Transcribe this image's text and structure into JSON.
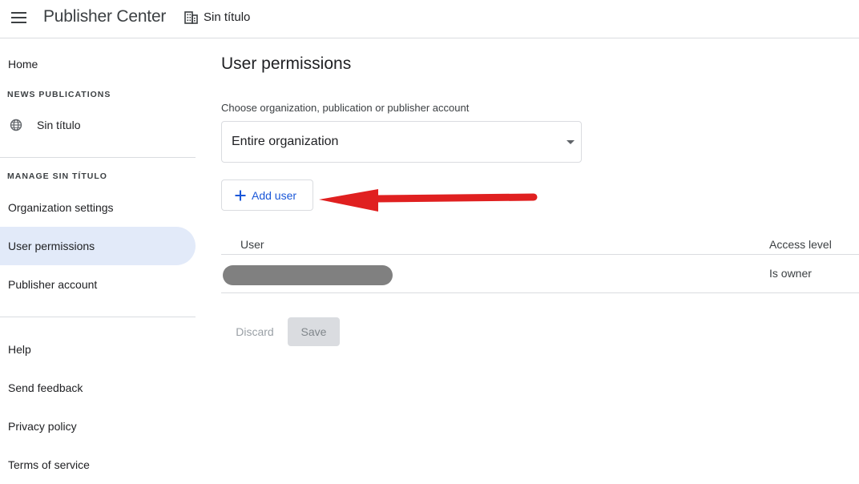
{
  "header": {
    "app_title": "Publisher Center",
    "org_name": "Sin título",
    "icons": {
      "menu": "menu-icon",
      "org": "building-icon"
    }
  },
  "sidebar": {
    "home": "Home",
    "news_publications_label": "NEWS PUBLICATIONS",
    "publication": {
      "label": "Sin título",
      "icon": "globe-icon"
    },
    "manage_label": "MANAGE SIN TÍTULO",
    "manage_items": [
      {
        "label": "Organization settings"
      },
      {
        "label": "User permissions",
        "active": true
      },
      {
        "label": "Publisher account"
      }
    ],
    "footer_items": [
      {
        "label": "Help"
      },
      {
        "label": "Send feedback"
      },
      {
        "label": "Privacy policy"
      },
      {
        "label": "Terms of service"
      }
    ],
    "active_color": "#e2eaf9"
  },
  "main": {
    "title": "User permissions",
    "select_label": "Choose organization, publication or publisher account",
    "select_value": "Entire organization",
    "add_user_label": "Add user",
    "table": {
      "headers": [
        "User",
        "Access level"
      ],
      "rows": [
        {
          "user": "",
          "access_level": "Is owner"
        }
      ]
    },
    "discard_label": "Discard",
    "save_label": "Save",
    "accent_color": "#1a57d8",
    "annotation_color": "#e02020"
  }
}
